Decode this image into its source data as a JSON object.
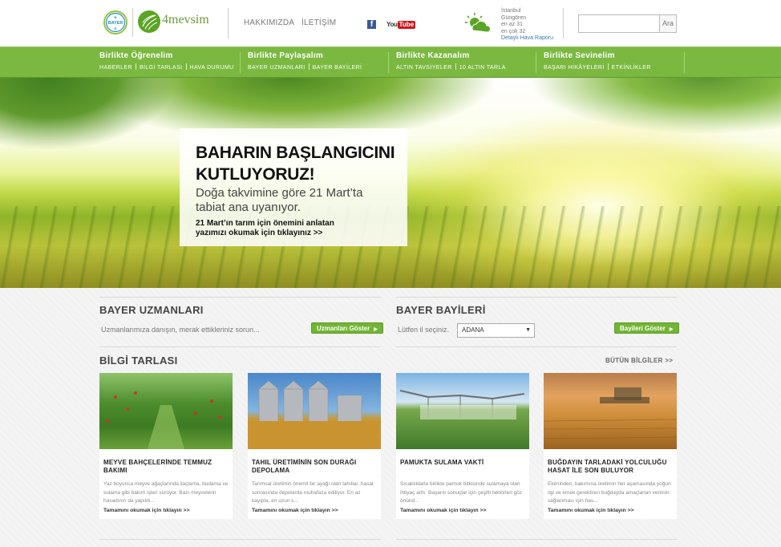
{
  "header": {
    "bayer_logo_text": "BAYER",
    "brand_name": "4mevsim",
    "links": [
      "HAKKIMIZDA",
      "İLETİŞİM"
    ],
    "social": {
      "facebook": "f",
      "youtube_you": "You",
      "youtube_tube": "Tube"
    },
    "weather": {
      "city": "İstanbul",
      "district": "Güngören",
      "min": "en az 31",
      "max": "en çok 32",
      "link": "Detaylı Hava Raporu"
    },
    "search": {
      "placeholder": "",
      "button_label": "Ara"
    }
  },
  "nav": [
    {
      "title": "Birlikte Öğrenelim",
      "items": [
        "HABERLER",
        "BİLGİ TARLASI",
        "HAVA DURUMU"
      ]
    },
    {
      "title": "Birlikte Paylaşalım",
      "items": [
        "BAYER UZMANLARI",
        "BAYER BAYİLERİ"
      ]
    },
    {
      "title": "Birlikte Kazanalım",
      "items": [
        "ALTIN TAVSİYELER",
        "10 ALTIN TARLA"
      ]
    },
    {
      "title": "Birlikte Sevinelim",
      "items": [
        "BAŞARI HİKÂYELERİ",
        "ETKİNLİKLER"
      ]
    }
  ],
  "hero": {
    "title_line1": "BAHARIN BAŞLANGICINI",
    "title_line2": "KUTLUYORUZ!",
    "subtitle_line1": "Doğa takvimine göre 21 Mart’ta",
    "subtitle_line2": "tabiat ana uyanıyor.",
    "cta_line1": "21 Mart’ın tarım için önemini anlatan",
    "cta_line2": "yazımızı okumak için tıklayınız >>"
  },
  "experts": {
    "title": "BAYER UZMANLARI",
    "description": "Uzmanlarımıza danışın, merak ettikleriniz sorun...",
    "button_label": "Uzmanları Göster"
  },
  "dealers": {
    "title": "BAYER BAYİLERİ",
    "description": "Lütfen il seçiniz.",
    "selected_city": "ADANA",
    "button_label": "Bayileri Göster"
  },
  "bilgi_tarlasi": {
    "title": "BİLGİ TARLASI",
    "all_link": "BÜTÜN BİLGİLER >>",
    "cards": [
      {
        "title": "MEYVE BAHÇELERİNDE TEMMUZ BAKIMI",
        "text": "Yaz boyunca meyve ağaçlarında ilaçlama, budama ve sulama gibi bakım işleri sürüyor. Bazı meyvelerin hasadının da yapıldı...",
        "more": "Tamamını okumak için tıklayın >>",
        "image": "apple-orchard"
      },
      {
        "title": "TAHIL ÜRETİMİNİN SON DURAĞI DEPOLAMA",
        "text": "Tarımsal üretimin önemli bir ayağı olan tahıllar, hasat sonrasında depolarda muhafaza ediliyor. En az kayıpla, en uzun s...",
        "more": "Tamamını okumak için tıklayın >>",
        "image": "grain-silos"
      },
      {
        "title": "PAMUKTA SULAMA VAKTİ",
        "text": "Sıcaklıklarla birlikte pamuk bitkisinde sulamaya olan ihtiyaç arttı. Başarılı sonuçlar için çeşitli faktörleri göz önünd...",
        "more": "Tamamını okumak için tıklayın >>",
        "image": "irrigation"
      },
      {
        "title": "BUĞDAYIN TARLADAKİ YOLCULUĞU HASAT İLE SON BULUYOR",
        "text": "Ekiminden, bakımına üretimin her aşamasında yoğun ilgi ve emek gerektiren buğdayda amaçlanan verimin sağlanması için has...",
        "more": "Tamamını okumak için tıklayın >>",
        "image": "wheat-harvest"
      }
    ]
  },
  "colors": {
    "nav_green": "#7ab840",
    "button_green": "#72b534",
    "link_blue": "#3a7ab0"
  }
}
